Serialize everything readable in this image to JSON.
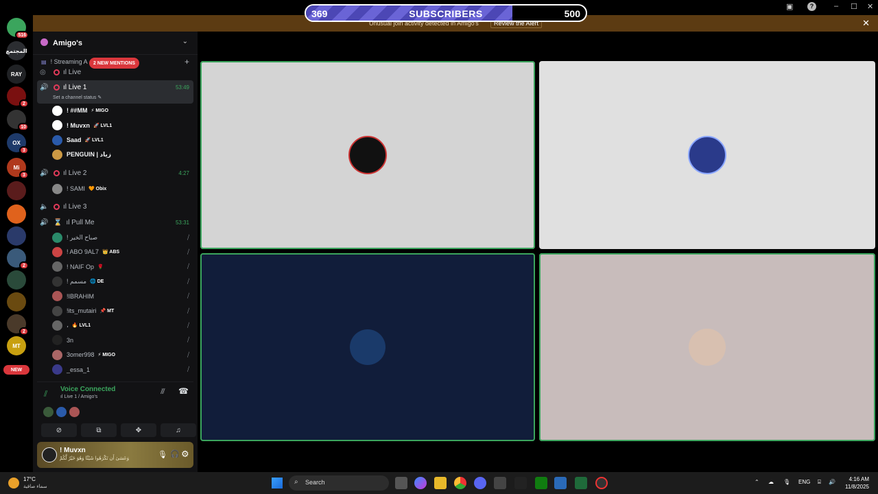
{
  "subscribers": {
    "current": "369",
    "label": "SUBSCRIBERS",
    "goal": "500",
    "progress_fraction": 0.738
  },
  "alert": {
    "text": "Unusual join activity detected in Amigo's",
    "action": "Review the Alert"
  },
  "rail": {
    "servers": [
      {
        "name": "home",
        "badge": "516",
        "color": "#3ba55d"
      },
      {
        "name": "server-arabic-text",
        "badge": "",
        "color": "#2b2d31",
        "text": "المجتمع"
      },
      {
        "name": "server-ray",
        "badge": "",
        "color": "#202225",
        "text": "RAY"
      },
      {
        "name": "server-red",
        "badge": "2",
        "color": "#7a1010"
      },
      {
        "name": "server-4",
        "badge": "10",
        "color": "#333"
      },
      {
        "name": "server-ox",
        "badge": "3",
        "color": "#1e3a6a",
        "text": "OX"
      },
      {
        "name": "server-mi",
        "badge": "3",
        "color": "#b0391c",
        "text": "Mi"
      },
      {
        "name": "server-8",
        "badge": "",
        "color": "#5a1c1c"
      },
      {
        "name": "server-9",
        "badge": "",
        "color": "#e0621c"
      },
      {
        "name": "server-10",
        "badge": "",
        "color": "#2a3a6a"
      },
      {
        "name": "server-11",
        "badge": "2",
        "color": "#3a5a7a"
      },
      {
        "name": "server-12",
        "badge": "",
        "color": "#2a4a3a"
      },
      {
        "name": "server-13",
        "badge": "",
        "color": "#6a4a10"
      },
      {
        "name": "server-14",
        "badge": "2",
        "color": "#4a3a2a"
      },
      {
        "name": "server-mt",
        "badge": "",
        "color": "#c8a010",
        "text": "MT"
      }
    ],
    "new_label": "NEW"
  },
  "sidebar": {
    "guild_name": "Amigo's",
    "category": "Streaming A",
    "mentions": "2 NEW MENTIONS",
    "channels": {
      "live": "Live",
      "live1": "Live 1",
      "live1_timer": "53:49",
      "status_hint": "Set a channel status",
      "live2": "Live 2",
      "live2_timer": "4:27",
      "live3": "Live 3",
      "pullme": "Pull Me",
      "pullme_timer": "53:31"
    },
    "live1_users": [
      {
        "name": "! ##MM",
        "tag": "⚡ MIGO",
        "color": "#fff"
      },
      {
        "name": "! Muvxn",
        "tag": "🚀 LVL1",
        "color": "#fff"
      },
      {
        "name": "Saad",
        "tag": "🚀 LVL1",
        "color": "#2a5aaa"
      },
      {
        "name": "PENGUIN | زياد",
        "tag": "",
        "color": "#c94"
      }
    ],
    "live2_users": [
      {
        "name": "! SAMI",
        "tag": "🧡 Obix",
        "color": "#888"
      }
    ],
    "pull_users": [
      {
        "name": "! صباح الخير",
        "tag": "",
        "color": "#2a8a6a"
      },
      {
        "name": "! ABO 9AL7",
        "tag": "👑 ABS",
        "color": "#c44"
      },
      {
        "name": "! NAIF Op",
        "tag": "🌹",
        "color": "#666"
      },
      {
        "name": "! مسمم",
        "tag": "🌐 DE",
        "color": "#333"
      },
      {
        "name": "!IBRAHIM",
        "tag": "",
        "color": "#a55"
      },
      {
        "name": "!its_mutairi",
        "tag": "📌 MT",
        "color": "#444"
      },
      {
        "name": "،",
        "tag": "🔥 LVL1",
        "color": "#666"
      },
      {
        "name": "3n",
        "tag": "",
        "color": "#222"
      },
      {
        "name": "3omer998",
        "tag": "⚡ MIGO",
        "color": "#a66"
      },
      {
        "name": "_essa_1",
        "tag": "",
        "color": "#3a3a8a"
      }
    ]
  },
  "voice": {
    "title": "Voice Connected",
    "subtitle": "Live 1 / Amigo's"
  },
  "user_panel": {
    "name": "! Muvxn",
    "status": "وَعَسَىٰ أَن تَكْرَهُوا شَيْئًا وَهُوَ خَيْرٌ لَّكُمْ"
  },
  "tiles": [
    {
      "bg": "#d4d4d4",
      "speaking": true,
      "avatar": "#111"
    },
    {
      "bg": "#e0e0e0",
      "speaking": false,
      "avatar": "#2a3a8a"
    },
    {
      "bg": "#111d3a",
      "speaking": true,
      "avatar": "#1a3a6a"
    },
    {
      "bg": "#c8bcbb",
      "speaking": true,
      "avatar": "#d8c0b0"
    }
  ],
  "taskbar": {
    "weather_temp": "17°C",
    "weather_desc": "سماء صافية",
    "search": "Search",
    "lang": "ENG",
    "time": "4:16 AM",
    "date": "11/8/2025"
  }
}
